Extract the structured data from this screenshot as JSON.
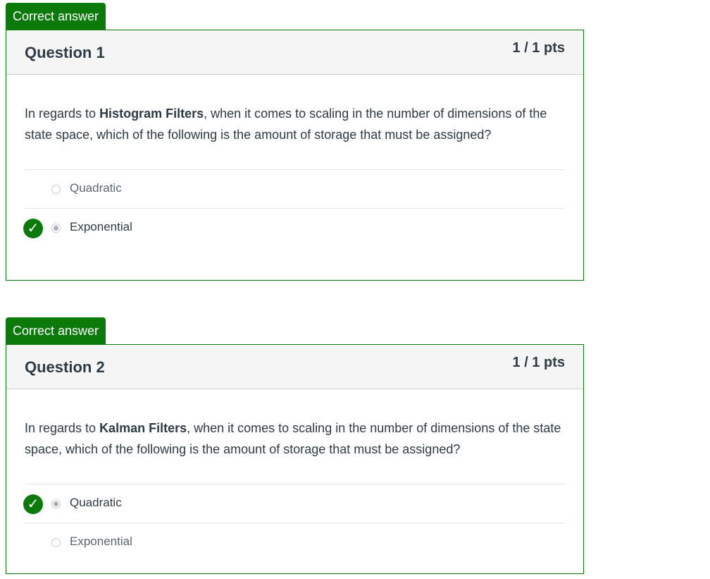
{
  "questions": [
    {
      "tag": "Correct answer",
      "title": "Question 1",
      "points": "1 / 1 pts",
      "text_before": "In regards to ",
      "text_bold": "Histogram Filters",
      "text_after": ", when it comes to scaling in the number of dimensions of the state space, which of the following is the amount of storage that must be assigned?",
      "answers": [
        {
          "label": "Quadratic",
          "selected": false,
          "correct": false
        },
        {
          "label": "Exponential",
          "selected": true,
          "correct": true
        }
      ]
    },
    {
      "tag": "Correct answer",
      "title": "Question 2",
      "points": "1 / 1 pts",
      "text_before": "In regards to ",
      "text_bold": "Kalman Filters",
      "text_after": ", when it comes to scaling in the number of dimensions of the state space, which of the following is the amount of storage that must be assigned?",
      "answers": [
        {
          "label": "Quadratic",
          "selected": true,
          "correct": true
        },
        {
          "label": "Exponential",
          "selected": false,
          "correct": false
        }
      ]
    }
  ],
  "icons": {
    "correct": "checkmark-icon"
  },
  "colors": {
    "correct_green": "#0b7a0b",
    "header_bg": "#f5f5f5",
    "text": "#2d3b45"
  }
}
